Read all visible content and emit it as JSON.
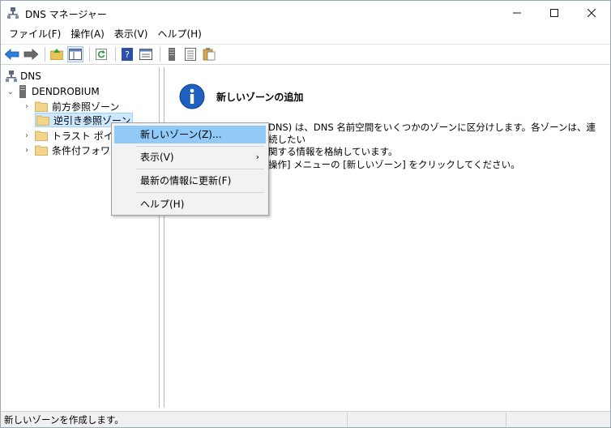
{
  "window": {
    "title": "DNS マネージャー"
  },
  "menubar": [
    "ファイル(F)",
    "操作(A)",
    "表示(V)",
    "ヘルプ(H)"
  ],
  "toolbar_icons": [
    "back-arrow-icon",
    "forward-arrow-icon",
    "up-folder-icon",
    "show-tree-icon",
    "refresh-icon",
    "help-icon",
    "properties-icon",
    "server-icon",
    "list-icon",
    "paste-icon"
  ],
  "tree": {
    "root": "DNS",
    "server": "DENDROBIUM",
    "zones": [
      "前方参照ゾーン",
      "逆引き参照ゾーン",
      "トラスト ポイント",
      "条件付フォワー"
    ]
  },
  "right": {
    "heading": "新しいゾーンの追加",
    "para1_line1": "DNS) は、DNS 名前空間をいくつかのゾーンに区分けします。各ゾーンは、連続したい",
    "para1_line2": "関する情報を格納しています。",
    "para2": "操作] メニューの [新しいゾーン] をクリックしてください。"
  },
  "context_menu": {
    "new_zone": "新しいゾーン(Z)...",
    "view": "表示(V)",
    "refresh": "最新の情報に更新(F)",
    "help": "ヘルプ(H)"
  },
  "status": {
    "text": "新しいゾーンを作成します。"
  },
  "colors": {
    "highlight": "#91c9f7",
    "selection": "#cde8ff",
    "info_blue": "#1f5fbf"
  }
}
